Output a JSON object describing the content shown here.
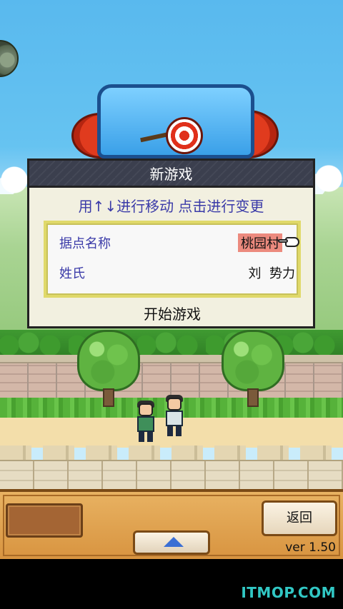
{
  "dialog": {
    "title": "新游戏",
    "instruction": "用↑↓进行移动 点击进行变更",
    "settings": [
      {
        "label": "据点名称",
        "value": "桃园村"
      },
      {
        "label": "姓氏",
        "value": "刘  势力"
      }
    ],
    "start_label": "开始游戏"
  },
  "bottom": {
    "back_label": "返回",
    "version": "ver 1.50"
  },
  "watermark": "ITMOP.COM",
  "colors": {
    "sky": "#59b9ee",
    "dialog_header": "#3b3f4e",
    "dialog_text": "#3a3aa8",
    "selected_bg": "#ec8a7e",
    "panel": "#e8b262",
    "watermark": "#31c7c4"
  },
  "icons": [
    "game-logo",
    "circular-badge-icon",
    "pointing-hand-icon",
    "up-arrow-icon"
  ]
}
